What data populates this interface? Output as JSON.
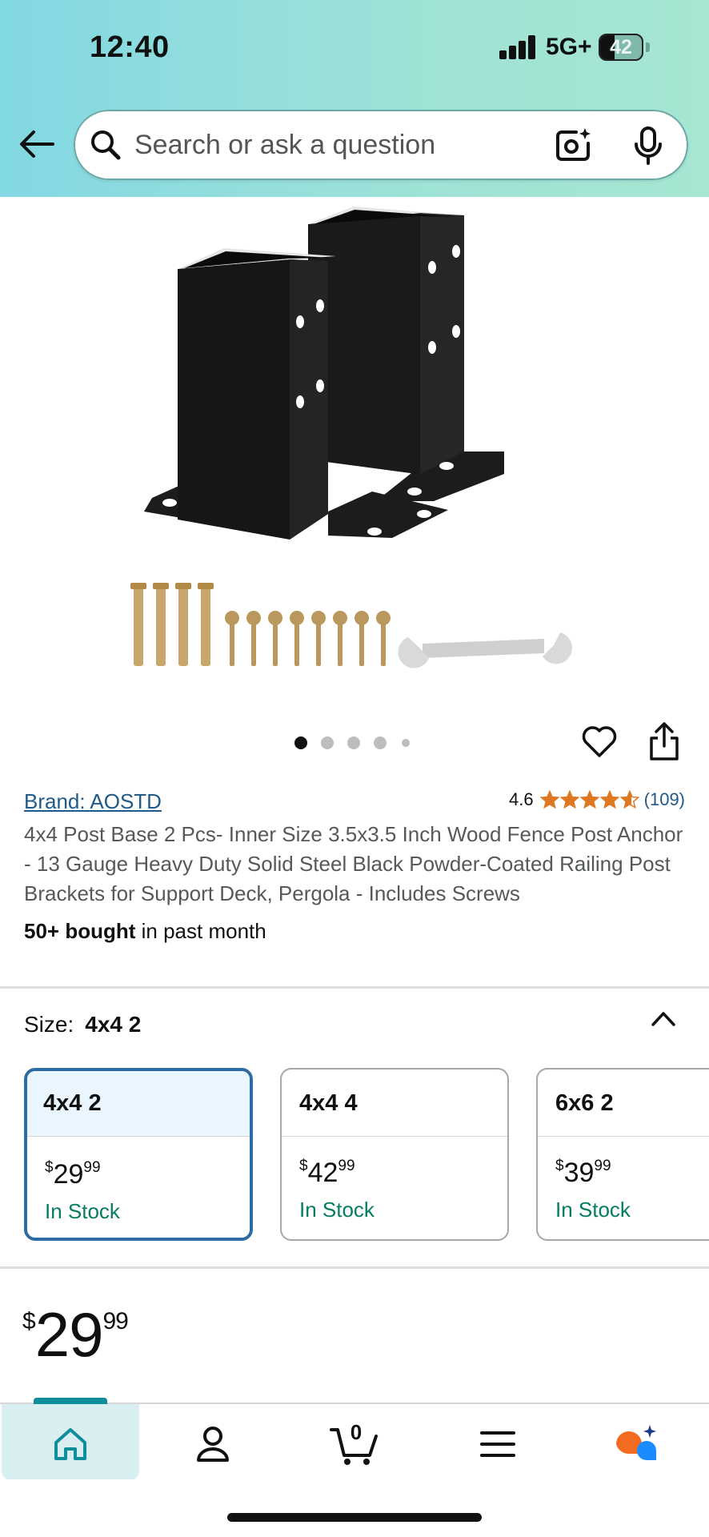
{
  "status_bar": {
    "time": "12:40",
    "network": "5G+",
    "battery": "42"
  },
  "search": {
    "placeholder": "Search or ask a question"
  },
  "gallery": {
    "image_count": 5,
    "active_index": 0
  },
  "product": {
    "brand": "Brand: AOSTD",
    "rating": "4.6",
    "rating_value": 4.6,
    "review_count": "(109)",
    "title": "4x4 Post Base 2 Pcs- Inner Size 3.5x3.5 Inch Wood Fence Post Anchor - 13 Gauge Heavy Duty Solid Steel Black Powder-Coated Railing Post Brackets for Support Deck, Pergola - Includes Screws",
    "bought_bold": "50+ bought",
    "bought_rest": " in past month"
  },
  "size": {
    "label": "Size:",
    "selected": "4x4 2",
    "options": [
      {
        "name": "4x4 2",
        "currency": "$",
        "dollars": "29",
        "cents": "99",
        "stock": "In Stock"
      },
      {
        "name": "4x4 4",
        "currency": "$",
        "dollars": "42",
        "cents": "99",
        "stock": "In Stock"
      },
      {
        "name": "6x6 2",
        "currency": "$",
        "dollars": "39",
        "cents": "99",
        "stock": "In Stock"
      }
    ]
  },
  "price": {
    "currency": "$",
    "dollars": "29",
    "cents": "99"
  },
  "nav": {
    "cart_count": "0",
    "items": [
      "home-icon",
      "account-icon",
      "cart-icon",
      "menu-icon",
      "rufus-icon"
    ]
  },
  "colors": {
    "header_gradient_start": "#82d8e3",
    "header_gradient_end": "#a6e6d2",
    "link": "#1f5a8a",
    "in_stock": "#067d62",
    "star": "#de7921",
    "selected_border": "#2e6ba2",
    "nav_accent": "#0e8e9a"
  }
}
